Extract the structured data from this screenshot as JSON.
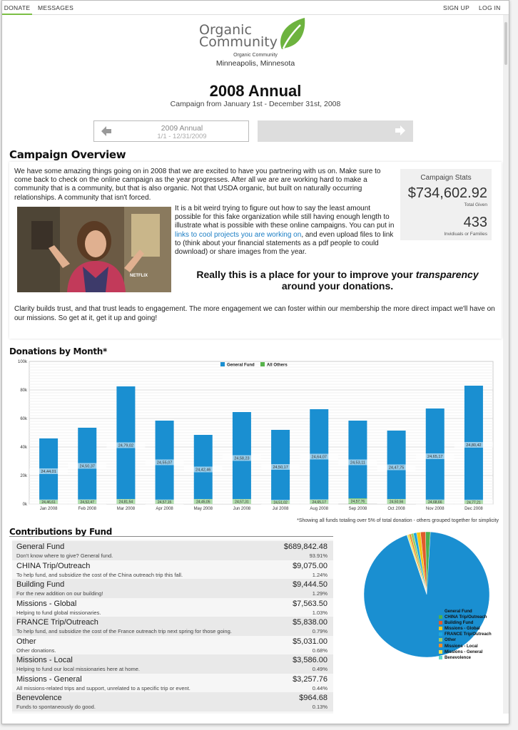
{
  "nav": {
    "tabs": [
      {
        "label": "DONATE",
        "active": true
      },
      {
        "label": "MESSAGES",
        "active": false
      }
    ],
    "right": [
      {
        "label": "SIGN UP"
      },
      {
        "label": "LOG IN"
      }
    ]
  },
  "header": {
    "logo_line1": "Organic",
    "logo_line2": "Community",
    "org_name": "Organic Community",
    "location": "Minneapolis, Minnesota",
    "campaign_title": "2008 Annual",
    "campaign_range": "Campaign from January 1st - December 31st, 2008",
    "brand_color": "#6db33f"
  },
  "prev_campaign": {
    "title": "2009 Annual",
    "dates": "1/1 - 12/31/2009"
  },
  "overview": {
    "heading": "Campaign Overview",
    "paragraph1": "We have some amazing things going on in 2008 that we are excited to have you partnering with us on. Make sure to come back to check on the online campaign as the year progresses. After all we are are working hard to make a community that is a community, but that is also organic. Not that USDA organic, but built on naturally occurring relationships. A community that isn't forced.",
    "paragraph2_before": "It is a bit weird trying to figure out how to say the least amount possible for this fake organization while still having enough length to illustrate what is possible with these online campaigns. You can put in ",
    "paragraph2_link": "links to cool projects you are working on",
    "paragraph2_after": ", and even upload files to link to (think about your financial statements as a pdf people to could download) or share images from the year.",
    "image_watermark": "NETFLIX",
    "quote_before": "Really this is a place for your to improve your ",
    "quote_emph": "transparency",
    "quote_after": " around your donations.",
    "paragraph3": "Clarity builds trust, and that trust leads to engagement. The more engagement we can foster within our membership the more direct impact we'll have on our missions. So get at it, get it up and going!"
  },
  "stats": {
    "heading": "Campaign Stats",
    "total_value": "$734,602.92",
    "total_label": "Total Given",
    "count_value": "433",
    "count_label": "Invidiuals or Families"
  },
  "donations_heading": "Donations by Month*",
  "chart_data": {
    "type": "bar",
    "title": "",
    "xlabel": "",
    "ylabel": "",
    "ylim": [
      0,
      100000
    ],
    "yticks": [
      "0k",
      "20k",
      "40k",
      "60k",
      "80k",
      "100k"
    ],
    "categories": [
      "Jan 2008",
      "Feb 2008",
      "Mar 2008",
      "Apr 2008",
      "May 2008",
      "Jun 2008",
      "Jul 2008",
      "Aug 2008",
      "Sep 2008",
      "Oct 2008",
      "Nov 2008",
      "Dec 2008"
    ],
    "legend_position": "top-center",
    "grid": true,
    "series": [
      {
        "name": "General Fund",
        "color": "#1a8fd1",
        "values": [
          46000,
          53500,
          82500,
          58500,
          48500,
          64500,
          52000,
          66500,
          58500,
          51500,
          67000,
          83000
        ]
      },
      {
        "name": "All Others",
        "color": "#56b34a",
        "values": [
          2800,
          3000,
          3500,
          2800,
          3500,
          3500,
          2500,
          3000,
          4000,
          3500,
          2800,
          2600
        ]
      }
    ],
    "bar_labels": [
      "24,44,01",
      "24,50,37",
      "24,79,02",
      "24,55,07",
      "24,42,46",
      "24,58,23",
      "24,50,17",
      "24,64,07",
      "24,53,11",
      "24,47,75",
      "24,65,17",
      "24,80,42"
    ],
    "others_labels": [
      "24,46,61",
      "24,52,47",
      "24,81,54",
      "24,57,15",
      "24,45,05",
      "24,57,31",
      "24,51,02",
      "24,65,17",
      "24,57,76",
      "24,50,56",
      "24,68,66",
      "24,77,21"
    ]
  },
  "chart_footnote": "*Showing all funds totaling over 5% of total donation - others grouped together for simplicity",
  "contributions_heading": "Contributions by Fund",
  "funds": [
    {
      "name": "General Fund",
      "amount": "$689,842.48",
      "desc": "Don't know where to give? General fund.",
      "pct": "93.91%",
      "color": "#1a8fd1",
      "share": 93.91
    },
    {
      "name": "CHINA Trip/Outreach",
      "amount": "$9,075.00",
      "desc": "To help fund, and subsidize the cost of the China outreach trip this fall.",
      "pct": "1.24%",
      "color": "#4caf50",
      "share": 1.24
    },
    {
      "name": "Building Fund",
      "amount": "$9,444.50",
      "desc": "For the new addition on our building!",
      "pct": "1.29%",
      "color": "#e25a2c",
      "share": 1.29
    },
    {
      "name": "Missions - Global",
      "amount": "$7,563.50",
      "desc": "Helping to fund global missionaries.",
      "pct": "1.03%",
      "color": "#f5c518",
      "share": 1.03
    },
    {
      "name": "FRANCE Trip/Outreach",
      "amount": "$5,838.00",
      "desc": "To help fund, and subsidize the cost of the France outreach trip next spring for those going.",
      "pct": "0.79%",
      "color": "#1aa7e0",
      "share": 0.79
    },
    {
      "name": "Other",
      "amount": "$5,031.00",
      "desc": "Other donations.",
      "pct": "0.68%",
      "color": "#9ccc65",
      "share": 0.68
    },
    {
      "name": "Missions - Local",
      "amount": "$3,586.00",
      "desc": "Helping to fund our local missionaries here at home.",
      "pct": "0.49%",
      "color": "#f08a2a",
      "share": 0.49
    },
    {
      "name": "Missions - General",
      "amount": "$3,257.76",
      "desc": "All missions-related trips and support, unrelated to a specific trip or event.",
      "pct": "0.44%",
      "color": "#f4e04d",
      "share": 0.44
    },
    {
      "name": "Benevolence",
      "amount": "$964.68",
      "desc": "Funds to spontaneously do good.",
      "pct": "0.13%",
      "color": "#64d8cb",
      "share": 0.13
    }
  ],
  "pie_legend": [
    "General Fund",
    "CHINA Trip/Outreach",
    "Building Fund",
    "Missions - Global",
    "FRANCE Trip/Outreach",
    "Other",
    "Missions - Local",
    "Missions - General",
    "Benevolence"
  ]
}
